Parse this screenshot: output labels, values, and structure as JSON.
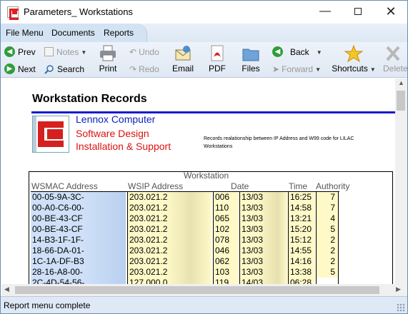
{
  "window": {
    "title": "Parameters_ Workstations",
    "controls": {
      "minimize": "—",
      "maximize": "",
      "close": "✕"
    }
  },
  "menu": [
    "File Menu",
    "Documents",
    "Reports"
  ],
  "toolbar": {
    "prev": "Prev",
    "next": "Next",
    "notes": "Notes",
    "search": "Search",
    "print": "Print",
    "undo": "Undo",
    "redo": "Redo",
    "email": "Email",
    "pdf": "PDF",
    "files": "Files",
    "back": "Back",
    "forward": "Forward",
    "shortcuts": "Shortcuts",
    "delete": "Delete"
  },
  "report": {
    "title": "Workstation Records",
    "company": [
      "Lennox Computer",
      "Software Design",
      "Installation & Support"
    ],
    "description": "Records realationship between IP Address and W99 code for LILAC Workstations",
    "headers": {
      "mac": "WSMAC Address",
      "ip": "WSIP Address",
      "workstation": "Workstation",
      "date": "Date",
      "time": "Time",
      "authority": "Authority"
    },
    "rows": [
      {
        "mac": "00-05-9A-3C-",
        "ip": "203.021.2",
        "ws": "006",
        "date": "13/03",
        "time": "16:25",
        "auth": "7"
      },
      {
        "mac": "00-A0-C6-00-",
        "ip": "203.021.2",
        "ws": "110",
        "date": "13/03",
        "time": "14:58",
        "auth": "7"
      },
      {
        "mac": "00-BE-43-CF",
        "ip": "203.021.2",
        "ws": "065",
        "date": "13/03",
        "time": "13:21",
        "auth": "4"
      },
      {
        "mac": "00-BE-43-CF",
        "ip": "203.021.2",
        "ws": "102",
        "date": "13/03",
        "time": "15:20",
        "auth": "5"
      },
      {
        "mac": "14-B3-1F-1F-",
        "ip": "203.021.2",
        "ws": "078",
        "date": "13/03",
        "time": "15:12",
        "auth": "2"
      },
      {
        "mac": "18-66-DA-01-",
        "ip": "203.021.2",
        "ws": "046",
        "date": "13/03",
        "time": "14:55",
        "auth": "2"
      },
      {
        "mac": "1C-1A-DF-B3",
        "ip": "203.021.2",
        "ws": "062",
        "date": "13/03",
        "time": "14:16",
        "auth": "2"
      },
      {
        "mac": "28-16-A8-00-",
        "ip": "203.021.2",
        "ws": "103",
        "date": "13/03",
        "time": "13:38",
        "auth": "5"
      },
      {
        "mac": "2C-4D-54-56-",
        "ip": "127.000.0",
        "ws": "119",
        "date": "14/03",
        "time": "06:28",
        "auth": ""
      }
    ]
  },
  "status": {
    "text": "Report menu complete"
  },
  "colors": {
    "accent": "#1a1acc",
    "brand_red": "#d61f1f",
    "brand_blue": "#0a1fbf",
    "mac_cell": "#cfe0f8",
    "data_cell": "#fff9c8"
  }
}
